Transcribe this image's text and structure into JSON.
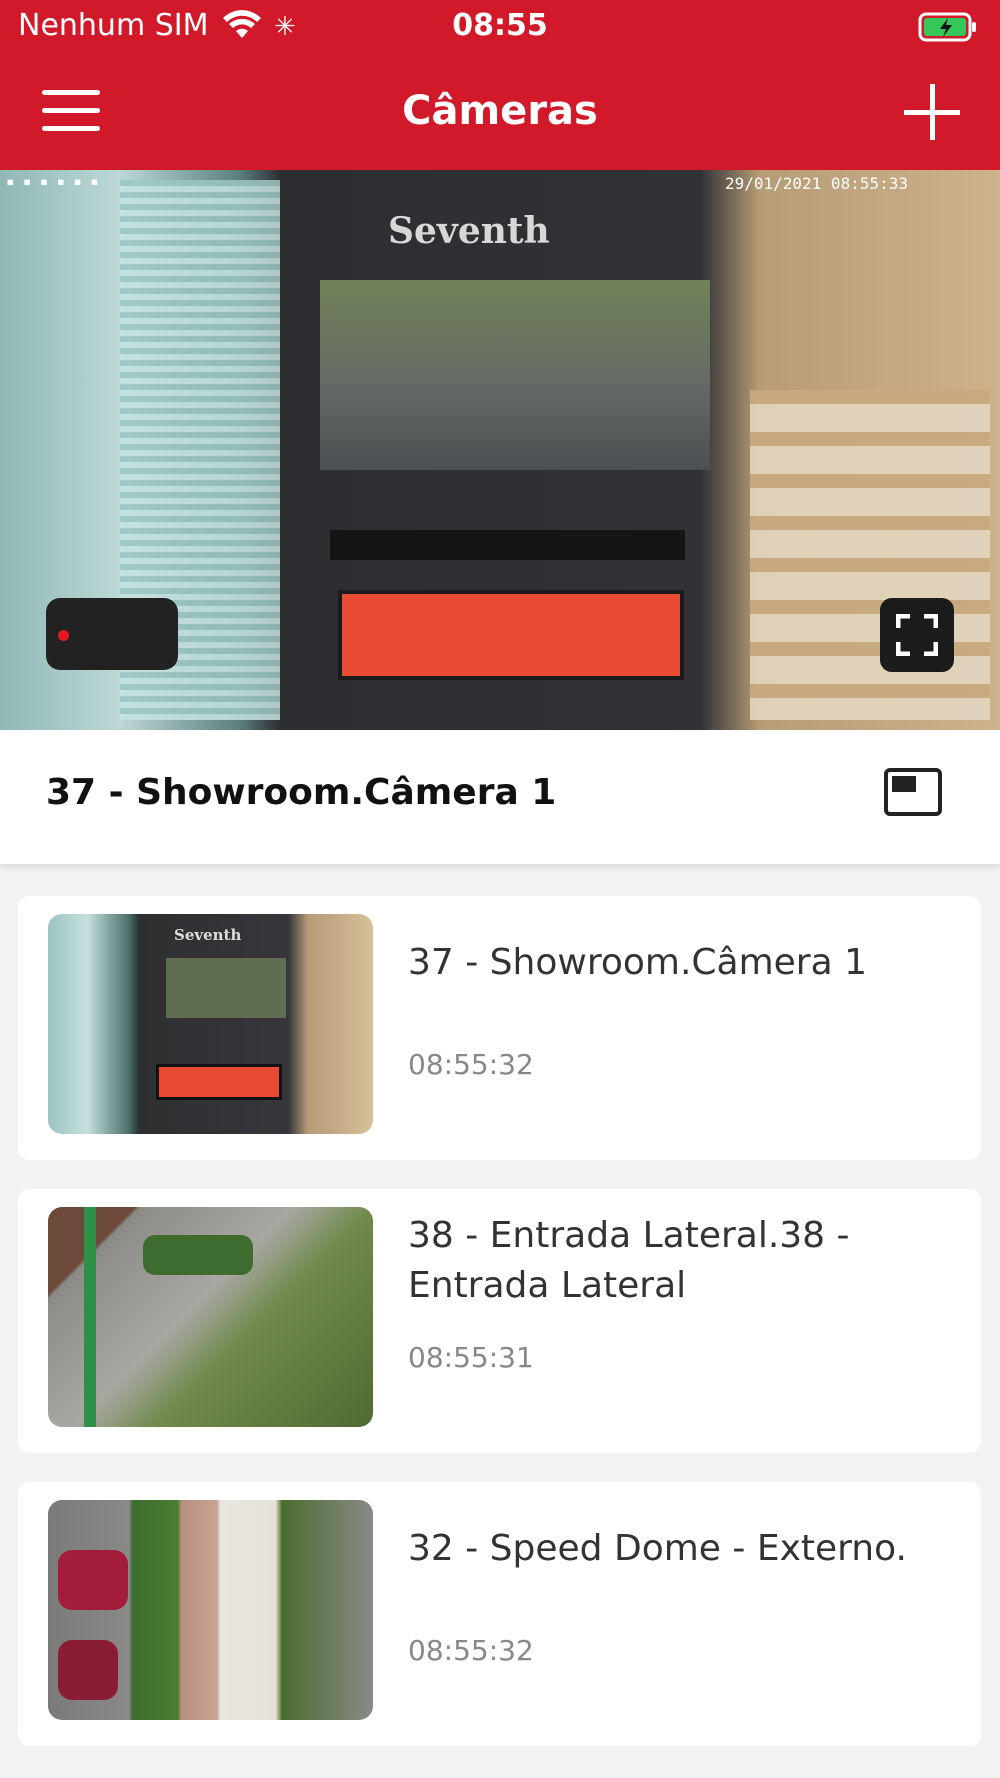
{
  "status_bar": {
    "carrier": "Nenhum SIM",
    "time": "08:55",
    "spinner": "✳"
  },
  "header": {
    "title": "Câmeras",
    "menu_icon": "hamburger-menu-icon",
    "add_icon": "plus-icon"
  },
  "live_view": {
    "brand": "Seventh",
    "osd_timestamp": "29/01/2021 08:55:33",
    "fullscreen_icon": "fullscreen-icon"
  },
  "selected_camera": {
    "name": "37 - Showroom.Câmera 1",
    "pip_icon": "picture-in-picture-icon"
  },
  "cameras": [
    {
      "name": "37 - Showroom.Câmera 1",
      "time": "08:55:32"
    },
    {
      "name": "38 - Entrada Lateral.38 - Entrada Lateral",
      "time": "08:55:31"
    },
    {
      "name": "32 - Speed Dome - Externo.",
      "time": "08:55:32"
    }
  ],
  "colors": {
    "brand_red": "#d1192a",
    "background": "#f2f2f4"
  }
}
